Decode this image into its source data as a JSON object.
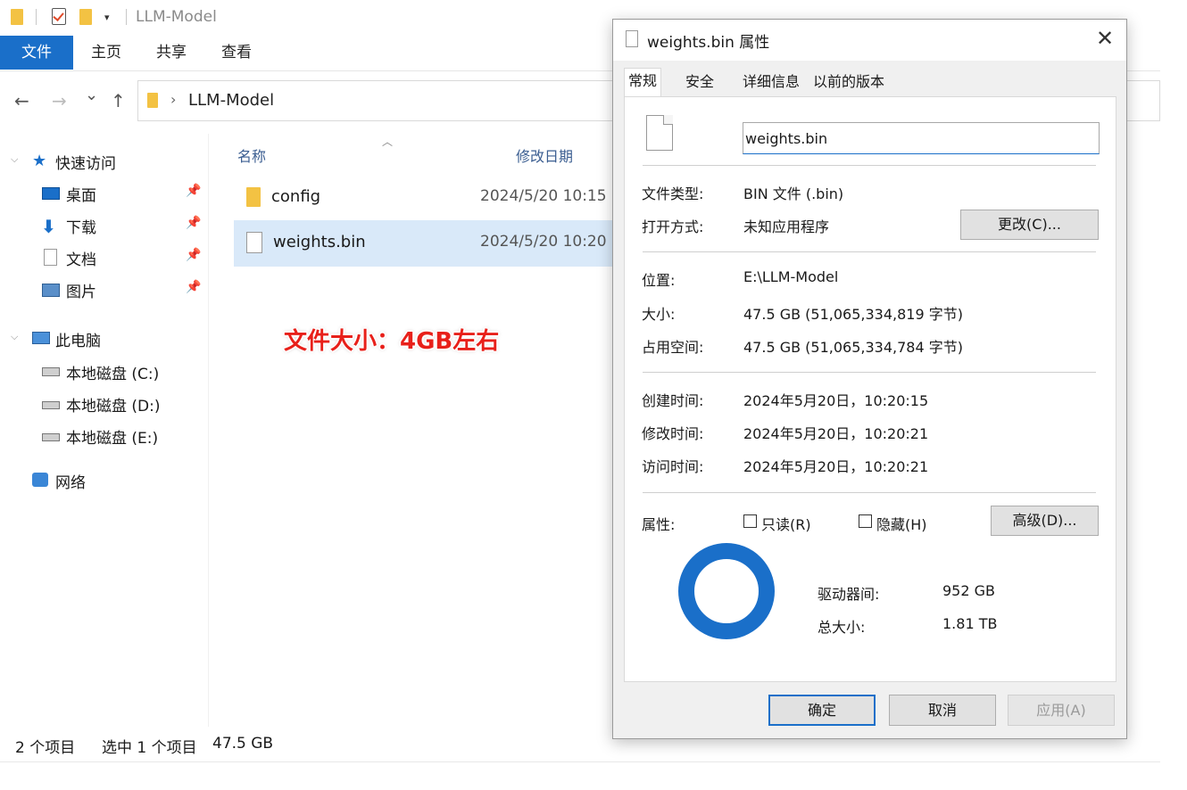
{
  "window": {
    "title": "LLM-Model",
    "qa_dropdown": "▾"
  },
  "ribbon": {
    "tabs": [
      "文件",
      "主页",
      "共享",
      "查看"
    ]
  },
  "address": {
    "back": "←",
    "forward": "→",
    "recent": "⌄",
    "up": "↑",
    "separator": "›",
    "path": "LLM-Model"
  },
  "sidebar": {
    "quick_access": "快速访问",
    "items": [
      "桌面",
      "下载",
      "文档",
      "图片"
    ],
    "this_pc": "此电脑",
    "drives": [
      "本地磁盘 (C:)",
      "本地磁盘 (D:)",
      "本地磁盘 (E:)"
    ],
    "network": "网络"
  },
  "content": {
    "columns": {
      "name": "名称",
      "modified": "修改日期"
    },
    "files": [
      {
        "name": "config",
        "date": "2024/5/20 10:15",
        "type": "folder"
      },
      {
        "name": "weights.bin",
        "date": "2024/5/20 10:20",
        "type": "file"
      }
    ]
  },
  "annotation": "文件大小：4GB左右",
  "status": {
    "count": "2 个项目",
    "selection": "选中 1 个项目",
    "size": "47.5 GB"
  },
  "dialog": {
    "title": "weights.bin 属性",
    "close": "✕",
    "tabs": [
      "常规",
      "安全",
      "详细信息",
      "以前的版本"
    ],
    "filename": "weights.bin",
    "props": {
      "type_label": "文件类型:",
      "type_value": "BIN 文件 (.bin)",
      "open_label": "打开方式:",
      "open_value": "未知应用程序",
      "change_button": "更改(C)...",
      "location_label": "位置:",
      "location_value": "E:\\LLM-Model",
      "size_label": "大小:",
      "size_value": "47.5 GB (51,065,334,819 字节)",
      "disk_label": "占用空间:",
      "disk_value": "47.5 GB (51,065,334,784 字节)",
      "created_label": "创建时间:",
      "created_value": "2024年5月20日，10:20:15",
      "modified_label": "修改时间:",
      "modified_value": "2024年5月20日，10:20:21",
      "accessed_label": "访问时间:",
      "accessed_value": "2024年5月20日，10:20:21",
      "attrs_label": "属性:",
      "readonly": "只读(R)",
      "hidden": "隐藏(H)",
      "advanced_button": "高级(D)..."
    },
    "drive": {
      "free_label": "驱动器间:",
      "free_value": "952 GB",
      "total_label": "总大小:",
      "total_value": "1.81 TB"
    },
    "buttons": {
      "ok": "确定",
      "cancel": "取消",
      "apply": "应用(A)"
    }
  },
  "colors": {
    "accent": "#1a6fc9",
    "selection": "#d9e9f9",
    "annotation": "#e8201a",
    "folder": "#f3c243"
  }
}
